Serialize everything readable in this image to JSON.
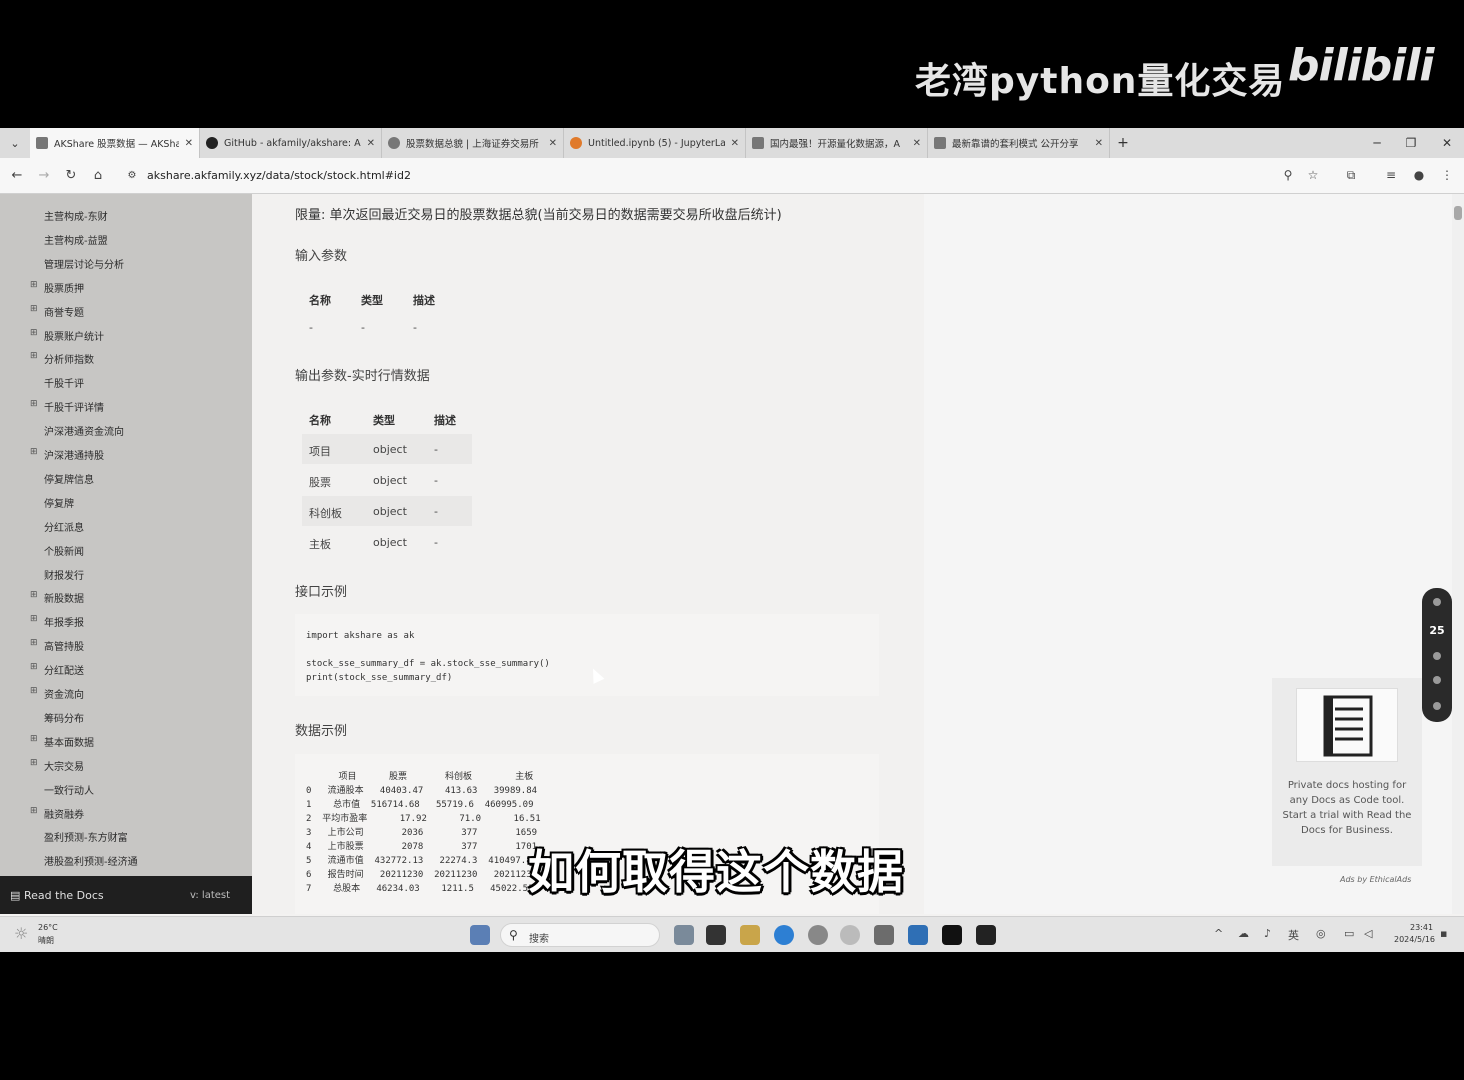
{
  "banner": {
    "channel_title": "老湾python量化交易",
    "logo_text": "bilibili"
  },
  "browser": {
    "tabs": [
      {
        "label": "AKShare 股票数据 — AKShare",
        "active": true
      },
      {
        "label": "GitHub - akfamily/akshare: A",
        "active": false
      },
      {
        "label": "股票数据总貌 | 上海证券交易所",
        "active": false
      },
      {
        "label": "Untitled.ipynb (5) - JupyterLa",
        "active": false
      },
      {
        "label": "国内最强！开源量化数据源，A",
        "active": false
      },
      {
        "label": "最新靠谱的套利模式 公开分享",
        "active": false
      }
    ],
    "url": "akshare.akfamily.xyz/data/stock/stock.html#id2"
  },
  "sidebar": {
    "items": [
      {
        "label": "主营构成-东财",
        "expandable": false
      },
      {
        "label": "主营构成-益盟",
        "expandable": false
      },
      {
        "label": "管理层讨论与分析",
        "expandable": false
      },
      {
        "label": "股票质押",
        "expandable": true
      },
      {
        "label": "商誉专题",
        "expandable": true
      },
      {
        "label": "股票账户统计",
        "expandable": true
      },
      {
        "label": "分析师指数",
        "expandable": true
      },
      {
        "label": "千股千评",
        "expandable": false
      },
      {
        "label": "千股千评详情",
        "expandable": true
      },
      {
        "label": "沪深港通资金流向",
        "expandable": false
      },
      {
        "label": "沪深港通持股",
        "expandable": true
      },
      {
        "label": "停复牌信息",
        "expandable": false
      },
      {
        "label": "停复牌",
        "expandable": false
      },
      {
        "label": "分红派息",
        "expandable": false
      },
      {
        "label": "个股新闻",
        "expandable": false
      },
      {
        "label": "财报发行",
        "expandable": false
      },
      {
        "label": "新股数据",
        "expandable": true
      },
      {
        "label": "年报季报",
        "expandable": true
      },
      {
        "label": "高管持股",
        "expandable": true
      },
      {
        "label": "分红配送",
        "expandable": true
      },
      {
        "label": "资金流向",
        "expandable": true
      },
      {
        "label": "筹码分布",
        "expandable": false
      },
      {
        "label": "基本面数据",
        "expandable": true
      },
      {
        "label": "大宗交易",
        "expandable": true
      },
      {
        "label": "一致行动人",
        "expandable": false
      },
      {
        "label": "融资融券",
        "expandable": true
      },
      {
        "label": "盈利预测-东方财富",
        "expandable": false
      },
      {
        "label": "港股盈利预测-经济通",
        "expandable": false
      }
    ],
    "rtd_label": "Read the Docs",
    "rtd_version": "v: latest"
  },
  "content": {
    "limit_text": "限量: 单次返回最近交易日的股票数据总貌(当前交易日的数据需要交易所收盘后统计)",
    "input_heading": "输入参数",
    "input_table": {
      "headers": [
        "名称",
        "类型",
        "描述"
      ],
      "rows": [
        [
          "-",
          "-",
          "-"
        ]
      ]
    },
    "output_heading": "输出参数-实时行情数据",
    "output_table": {
      "headers": [
        "名称",
        "类型",
        "描述"
      ],
      "rows": [
        [
          "项目",
          "object",
          "-"
        ],
        [
          "股票",
          "object",
          "-"
        ],
        [
          "科创板",
          "object",
          "-"
        ],
        [
          "主板",
          "object",
          "-"
        ]
      ]
    },
    "example_heading": "接口示例",
    "code_lines": [
      "import akshare as ak",
      "",
      "stock_sse_summary_df = ak.stock_sse_summary()",
      "print(stock_sse_summary_df)"
    ],
    "data_heading": "数据示例",
    "data_header": "      项目      股票       科创板        主板",
    "data_rows": [
      "0   流通股本   40403.47    413.63   39989.84",
      "1    总市值  516714.68   55719.6  460995.09",
      "2  平均市盈率      17.92      71.0      16.51",
      "3   上市公司       2036       377       1659",
      "4   上市股票       2078       377       1701",
      "5   流通市值  432772.13   22274.3  410497.83",
      "6   报告时间   20211230  20211230   20211230",
      "7    总股本   46234.03    1211.5   45022.53"
    ]
  },
  "float_panel": {
    "count": "25"
  },
  "ad": {
    "text": "Private docs hosting for any Docs as Code tool. Start a trial with Read the Docs for Business.",
    "by": "Ads by EthicalAds"
  },
  "taskbar": {
    "weather_temp": "26°C",
    "weather_cond": "晴朗",
    "search_placeholder": "搜索",
    "ime": "英",
    "time": "23:41",
    "date": "2024/5/16"
  },
  "subtitle": "如何取得这个数据"
}
